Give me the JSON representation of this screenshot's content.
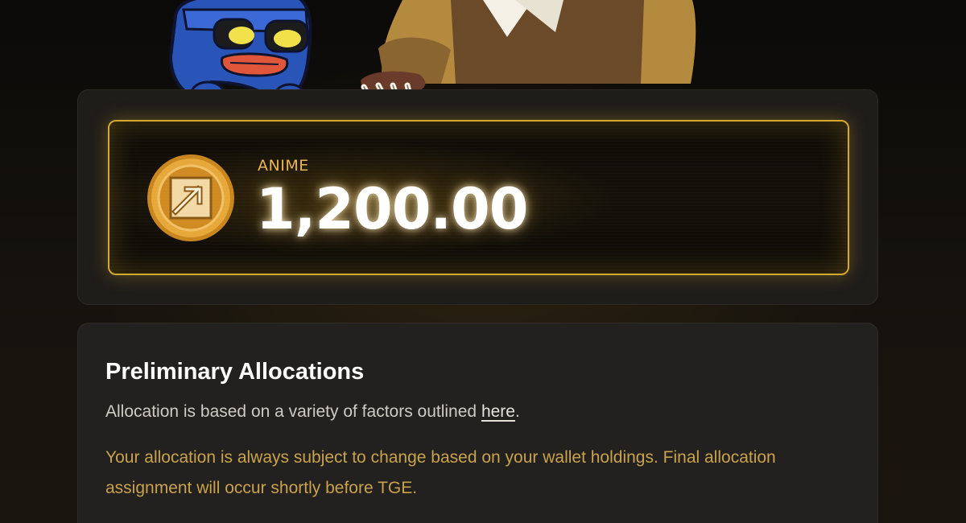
{
  "balance": {
    "token_symbol": "ANIME",
    "amount": "1,200.00",
    "coin_icon": "anime-coin-icon"
  },
  "info": {
    "title": "Preliminary Allocations",
    "description_prefix": "Allocation is based on a variety of factors outlined ",
    "description_link": "here",
    "description_suffix": ".",
    "note": "Your allocation is always subject to change based on your wallet holdings. Final allocation assignment will occur shortly before TGE."
  },
  "colors": {
    "accent_gold": "#d6a830",
    "note_text": "#c9a24a",
    "card_background": "#1f1d1a"
  }
}
